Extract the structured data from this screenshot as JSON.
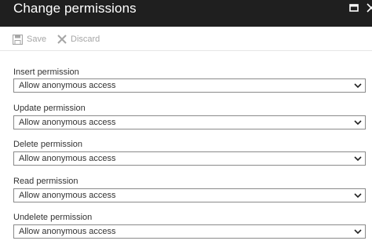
{
  "window": {
    "title": "Change permissions",
    "maximize_icon": "maximize-icon",
    "close_icon": "close-icon"
  },
  "toolbar": {
    "save_label": "Save",
    "save_icon": "save-icon",
    "discard_label": "Discard",
    "discard_icon": "discard-icon",
    "disabled_color": "#a6a6a6"
  },
  "fields": [
    {
      "label": "Insert permission",
      "value": "Allow anonymous access"
    },
    {
      "label": "Update permission",
      "value": "Allow anonymous access"
    },
    {
      "label": "Delete permission",
      "value": "Allow anonymous access"
    },
    {
      "label": "Read permission",
      "value": "Allow anonymous access"
    },
    {
      "label": "Undelete permission",
      "value": "Allow anonymous access"
    }
  ],
  "colors": {
    "header_bg": "#1f1f1f",
    "header_text": "#ffffff",
    "field_border": "#8a8a8a"
  }
}
